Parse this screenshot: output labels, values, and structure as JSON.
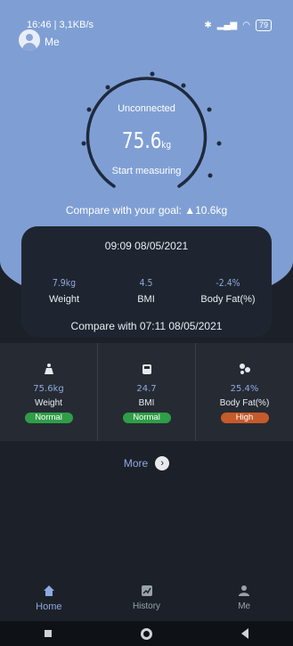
{
  "status_bar": {
    "time_net": "16:46 | 3,1KB/s",
    "battery": "79"
  },
  "header": {
    "user_label": "Me"
  },
  "gauge": {
    "status": "Unconnected",
    "weight_value": "75.6",
    "weight_unit": "kg",
    "action": "Start measuring"
  },
  "goal": {
    "text": "Compare with your goal: ▲10.6kg"
  },
  "card": {
    "timestamp": "09:09 08/05/2021",
    "metrics": [
      {
        "value": "7.9kg",
        "label": "Weight"
      },
      {
        "value": "4.5",
        "label": "BMI"
      },
      {
        "value": "-2.4%",
        "label": "Body Fat(%)"
      }
    ],
    "compare": "Compare with 07:11 08/05/2021"
  },
  "stats": [
    {
      "icon": "weight-icon",
      "value": "75.6kg",
      "label": "Weight",
      "badge": "Normal",
      "badge_color": "#2f9e47"
    },
    {
      "icon": "bmi-icon",
      "value": "24.7",
      "label": "BMI",
      "badge": "Normal",
      "badge_color": "#2f9e47"
    },
    {
      "icon": "body-fat-icon",
      "value": "25.4%",
      "label": "Body Fat(%)",
      "badge": "High",
      "badge_color": "#c55a2a"
    }
  ],
  "more": {
    "label": "More"
  },
  "nav": [
    {
      "icon": "home-icon",
      "label": "Home",
      "active": true
    },
    {
      "icon": "history-icon",
      "label": "History",
      "active": false
    },
    {
      "icon": "me-icon",
      "label": "Me",
      "active": false
    }
  ],
  "colors": {
    "hero_bg": "#7f9fd4",
    "accent": "#8ea9e0",
    "page_bg": "#1c2129",
    "normal": "#2f9e47",
    "high": "#c55a2a"
  }
}
